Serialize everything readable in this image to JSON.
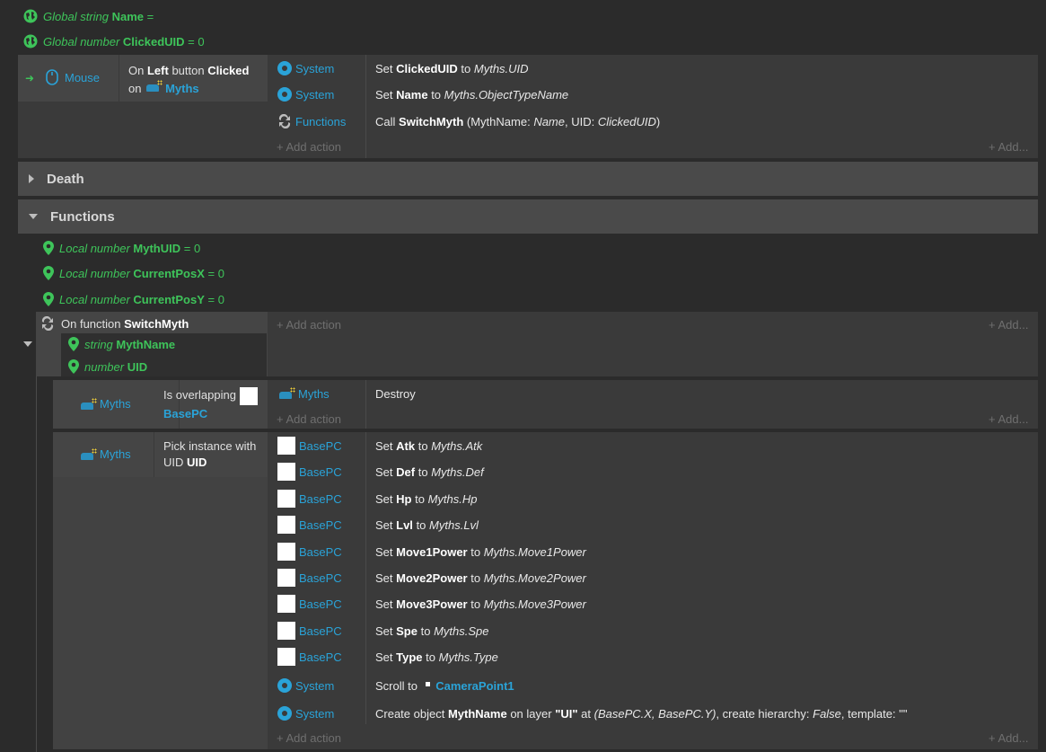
{
  "globals": [
    {
      "scope": "Global",
      "type": "string",
      "name": "Name",
      "value": "="
    },
    {
      "scope": "Global",
      "type": "number",
      "name": "ClickedUID",
      "value": "= 0"
    }
  ],
  "mouse_event": {
    "object": "Mouse",
    "condition": {
      "pre": "On",
      "button": "Left",
      "mid": "button",
      "trigger": "Clicked",
      "on": "on",
      "target": "Myths"
    },
    "actions": [
      {
        "object": "System",
        "verb": "Set",
        "var": "ClickedUID",
        "to": "to",
        "value": "Myths.UID"
      },
      {
        "object": "System",
        "verb": "Set",
        "var": "Name",
        "to": "to",
        "value": "Myths.ObjectTypeName"
      },
      {
        "object": "Functions",
        "verb": "Call",
        "func": "SwitchMyth",
        "params_open": "(MythName:",
        "p1": "Name",
        "comma": ", UID:",
        "p2": "ClickedUID",
        "close": ")"
      }
    ]
  },
  "groups": {
    "death": "Death",
    "functions": "Functions"
  },
  "locals": [
    {
      "scope": "Local",
      "type": "number",
      "name": "MythUID",
      "value": "= 0"
    },
    {
      "scope": "Local",
      "type": "number",
      "name": "CurrentPosX",
      "value": "= 0"
    },
    {
      "scope": "Local",
      "type": "number",
      "name": "CurrentPosY",
      "value": "= 0"
    }
  ],
  "function_block": {
    "label": "On function",
    "name": "SwitchMyth",
    "params": [
      {
        "type": "string",
        "name": "MythName"
      },
      {
        "type": "number",
        "name": "UID"
      }
    ]
  },
  "sub1": {
    "object": "Myths",
    "cond_text": "Is overlapping",
    "cond_target": "BasePC",
    "action_object": "Myths",
    "action_text": "Destroy"
  },
  "sub2": {
    "object": "Myths",
    "cond_text": "Pick instance with UID",
    "cond_var": "UID",
    "actions": [
      {
        "object": "BasePC",
        "var": "Atk",
        "value": "Myths.Atk"
      },
      {
        "object": "BasePC",
        "var": "Def",
        "value": "Myths.Def"
      },
      {
        "object": "BasePC",
        "var": "Hp",
        "value": "Myths.Hp"
      },
      {
        "object": "BasePC",
        "var": "Lvl",
        "value": "Myths.Lvl"
      },
      {
        "object": "BasePC",
        "var": "Move1Power",
        "value": "Myths.Move1Power"
      },
      {
        "object": "BasePC",
        "var": "Move2Power",
        "value": "Myths.Move2Power"
      },
      {
        "object": "BasePC",
        "var": "Move3Power",
        "value": "Myths.Move3Power"
      },
      {
        "object": "BasePC",
        "var": "Spe",
        "value": "Myths.Spe"
      },
      {
        "object": "BasePC",
        "var": "Type",
        "value": "Myths.Type"
      }
    ],
    "scroll": {
      "object": "System",
      "text": "Scroll to",
      "target": "CameraPoint1"
    },
    "create": {
      "object": "System",
      "pre": "Create object",
      "obj": "MythName",
      "mid": "on layer",
      "layer": "\"UI\"",
      "at": "at",
      "pos": "(BasePC.X, BasePC.Y)",
      "ch": ", create hierarchy:",
      "chv": "False",
      "tpl": ", template:",
      "tplv": "\"\""
    }
  },
  "labels": {
    "set": "Set",
    "to": "to",
    "add_action": "+ Add action",
    "add_more": "+ Add..."
  },
  "colors": {
    "background": "#2b2b2b",
    "accent_blue": "#2aa3d8",
    "accent_green": "#3ec45a"
  }
}
